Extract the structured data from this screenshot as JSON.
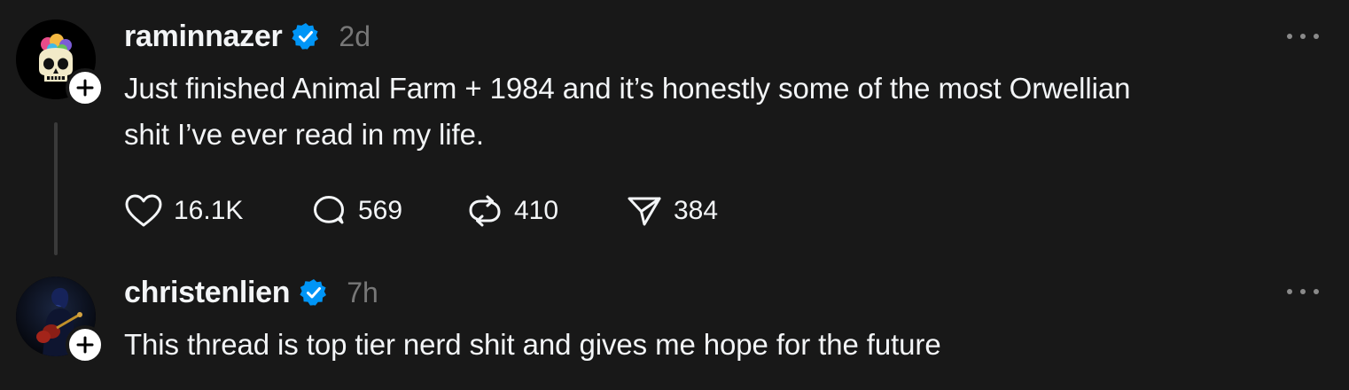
{
  "posts": [
    {
      "username": "raminnazer",
      "verified": true,
      "timestamp": "2d",
      "text_line_1": "Just finished Animal Farm + 1984 and it’s honestly some of the most Orwellian",
      "text_line_2": "shit I’ve ever read in my life.",
      "avatar_icon": "skull-with-colorful-brain-icon",
      "actions": {
        "likes": "16.1K",
        "replies": "569",
        "reposts": "410",
        "shares": "384"
      }
    },
    {
      "username": "christenlien",
      "verified": true,
      "timestamp": "7h",
      "text_line_1": "This thread is top tier nerd shit and gives me hope for the future",
      "avatar_icon": "person-with-guitar-photo"
    }
  ],
  "colors": {
    "background": "#181818",
    "text_primary": "#f3f5f7",
    "text_secondary": "#777777",
    "verified_blue": "#0095f6",
    "thread_line": "#3a3a3a"
  }
}
